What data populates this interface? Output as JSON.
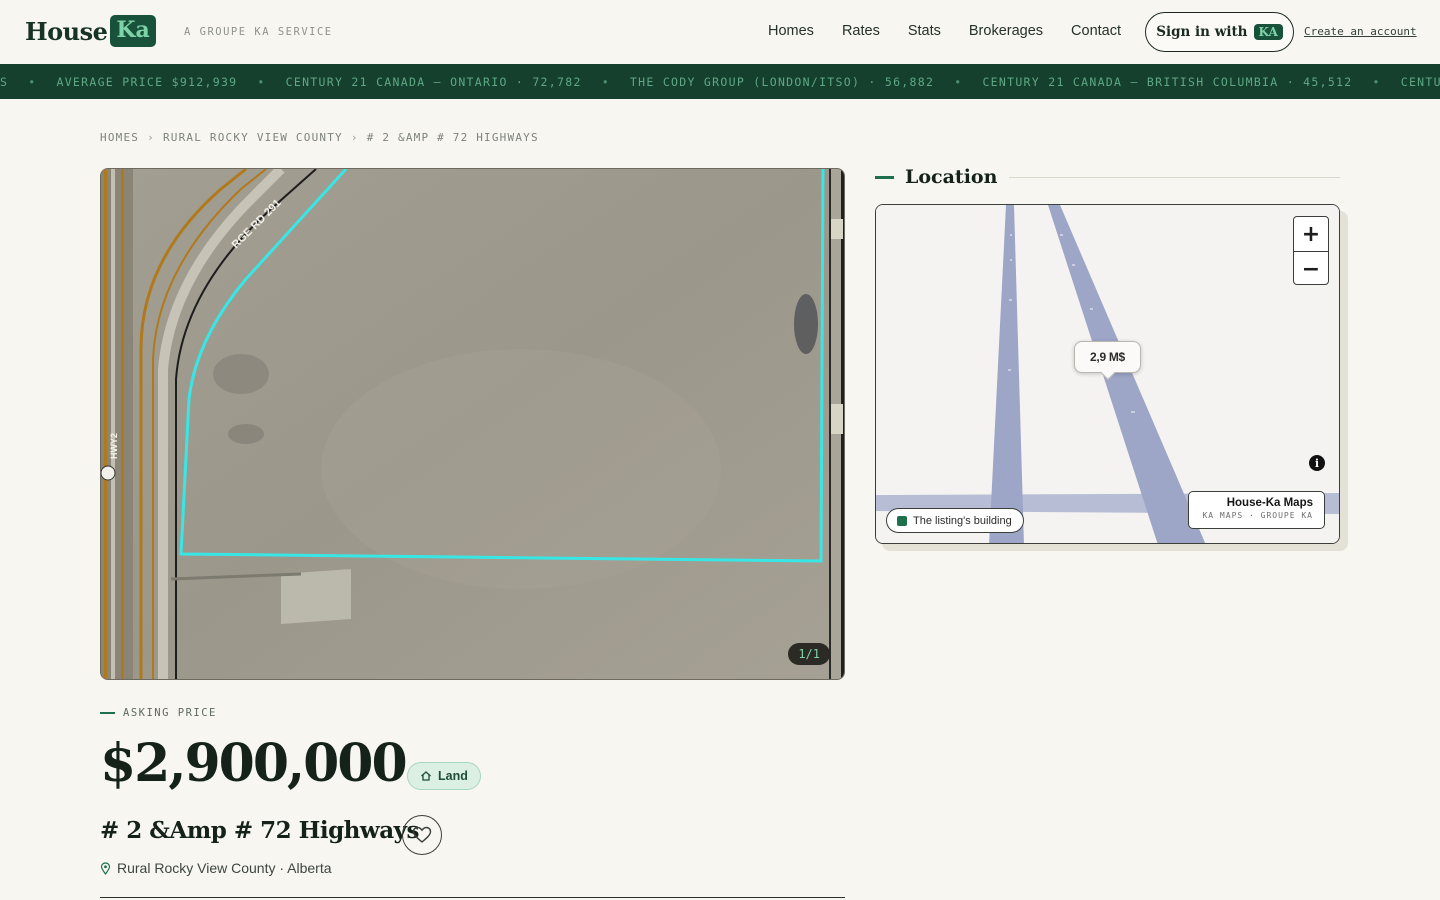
{
  "header": {
    "logo_word": "House",
    "logo_badge": "Ka",
    "tagline": "A GROUPE KA SERVICE",
    "nav": [
      "Homes",
      "Rates",
      "Stats",
      "Brokerages",
      "Contact"
    ],
    "signin_label": "Sign in with",
    "signin_badge": "KA",
    "create_account": "Create an account"
  },
  "ticker": {
    "items": [
      "S",
      "AVERAGE PRICE $912,939",
      "CENTURY 21 CANADA – ONTARIO · 72,782",
      "THE CODY GROUP (LONDON/ITSO) · 56,882",
      "CENTURY 21 CANADA – BRITISH COLUMBIA · 45,512",
      "CENTUR"
    ],
    "separator": "•"
  },
  "breadcrumb": [
    "HOMES",
    "RURAL ROCKY VIEW COUNTY",
    "# 2 &AMP # 72 HIGHWAYS"
  ],
  "breadcrumb_sep": "›",
  "photo": {
    "counter": "1/1",
    "road_label": "RGE RD 291",
    "hwy_label": "HWY2"
  },
  "listing": {
    "asking_label": "ASKING PRICE",
    "price": "$2,900,000",
    "type_badge": "Land",
    "address": "# 2 &Amp # 72 Highways",
    "location": "Rural Rocky View County · Alberta"
  },
  "location_section": {
    "title": "Location",
    "pin_label": "2,9 M$",
    "legend": "The listing's building",
    "attribution_title": "House-Ka Maps",
    "attribution_sub": "KA MAPS · GROUPE KA",
    "zoom_in": "+",
    "zoom_out": "−",
    "info": "i"
  },
  "colors": {
    "brand_green": "#18523a",
    "accent_mint": "#7fd2a8",
    "background": "#f8f6f0",
    "parcel_outline": "#39e6e6"
  }
}
